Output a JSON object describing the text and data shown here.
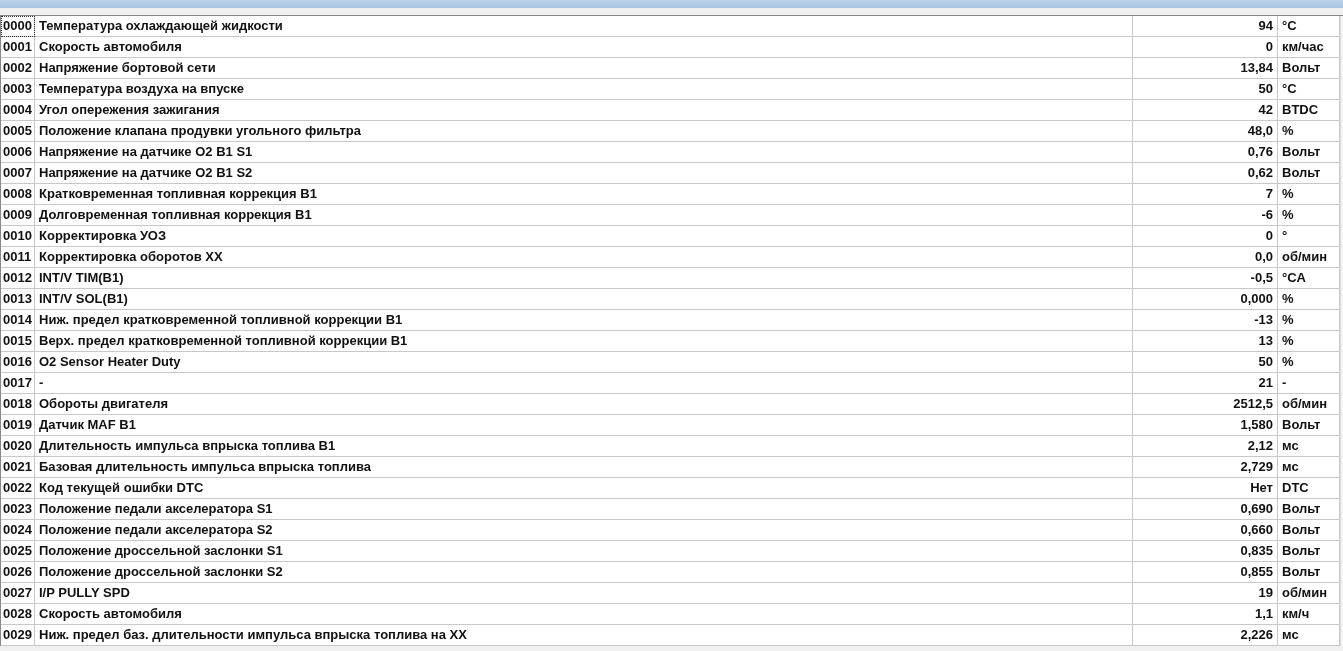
{
  "table": {
    "rows": [
      {
        "id": "0000",
        "name": "Температура охлаждающей жидкости",
        "value": "94",
        "unit": "°C",
        "focused": true
      },
      {
        "id": "0001",
        "name": "Скорость автомобиля",
        "value": "0",
        "unit": "км/час",
        "focused": false
      },
      {
        "id": "0002",
        "name": "Напряжение бортовой сети",
        "value": "13,84",
        "unit": "Вольт",
        "focused": false
      },
      {
        "id": "0003",
        "name": "Температура воздуха на впуске",
        "value": "50",
        "unit": "°C",
        "focused": false
      },
      {
        "id": "0004",
        "name": "Угол опережения зажигания",
        "value": "42",
        "unit": "BTDC",
        "focused": false
      },
      {
        "id": "0005",
        "name": "Положение клапана продувки угольного фильтра",
        "value": "48,0",
        "unit": "%",
        "focused": false
      },
      {
        "id": "0006",
        "name": "Напряжение на датчике O2 B1 S1",
        "value": "0,76",
        "unit": "Вольт",
        "focused": false
      },
      {
        "id": "0007",
        "name": "Напряжение на датчике O2 B1 S2",
        "value": "0,62",
        "unit": "Вольт",
        "focused": false
      },
      {
        "id": "0008",
        "name": "Кратковременная топливная коррекция B1",
        "value": "7",
        "unit": "%",
        "focused": false
      },
      {
        "id": "0009",
        "name": "Долговременная топливная коррекция B1",
        "value": "-6",
        "unit": "%",
        "focused": false
      },
      {
        "id": "0010",
        "name": "Корректировка УОЗ",
        "value": "0",
        "unit": "°",
        "focused": false
      },
      {
        "id": "0011",
        "name": "Корректировка оборотов ХХ",
        "value": "0,0",
        "unit": "об/мин",
        "focused": false
      },
      {
        "id": "0012",
        "name": "INT/V TIM(B1)",
        "value": "-0,5",
        "unit": "°CA",
        "focused": false
      },
      {
        "id": "0013",
        "name": "INT/V SOL(B1)",
        "value": "0,000",
        "unit": "%",
        "focused": false
      },
      {
        "id": "0014",
        "name": "Ниж. предел кратковременной топливной коррекции B1",
        "value": "-13",
        "unit": "%",
        "focused": false
      },
      {
        "id": "0015",
        "name": "Верх. предел кратковременной топливной коррекции B1",
        "value": "13",
        "unit": "%",
        "focused": false
      },
      {
        "id": "0016",
        "name": "O2 Sensor Heater Duty",
        "value": "50",
        "unit": "%",
        "focused": false
      },
      {
        "id": "0017",
        "name": "-",
        "value": "21",
        "unit": "-",
        "focused": false
      },
      {
        "id": "0018",
        "name": "Обороты двигателя",
        "value": "2512,5",
        "unit": "об/мин",
        "focused": false
      },
      {
        "id": "0019",
        "name": "Датчик MAF B1",
        "value": "1,580",
        "unit": "Вольт",
        "focused": false
      },
      {
        "id": "0020",
        "name": "Длительность импульса впрыска топлива B1",
        "value": "2,12",
        "unit": "мс",
        "focused": false
      },
      {
        "id": "0021",
        "name": "Базовая длительность импульса впрыска топлива",
        "value": "2,729",
        "unit": "мс",
        "focused": false
      },
      {
        "id": "0022",
        "name": "Код текущей ошибки DTC",
        "value": "Нет",
        "unit": "DTC",
        "focused": false
      },
      {
        "id": "0023",
        "name": "Положение педали акселератора S1",
        "value": "0,690",
        "unit": "Вольт",
        "focused": false
      },
      {
        "id": "0024",
        "name": "Положение педали акселератора S2",
        "value": "0,660",
        "unit": "Вольт",
        "focused": false
      },
      {
        "id": "0025",
        "name": "Положение дроссельной заслонки S1",
        "value": "0,835",
        "unit": "Вольт",
        "focused": false
      },
      {
        "id": "0026",
        "name": "Положение дроссельной заслонки S2",
        "value": "0,855",
        "unit": "Вольт",
        "focused": false
      },
      {
        "id": "0027",
        "name": "I/P PULLY SPD",
        "value": "19",
        "unit": "об/мин",
        "focused": false
      },
      {
        "id": "0028",
        "name": "Скорость автомобиля",
        "value": "1,1",
        "unit": "км/ч",
        "focused": false
      },
      {
        "id": "0029",
        "name": "Ниж. предел баз. длительности импульса впрыска топлива на ХХ",
        "value": "2,226",
        "unit": "мс",
        "focused": false
      }
    ]
  }
}
